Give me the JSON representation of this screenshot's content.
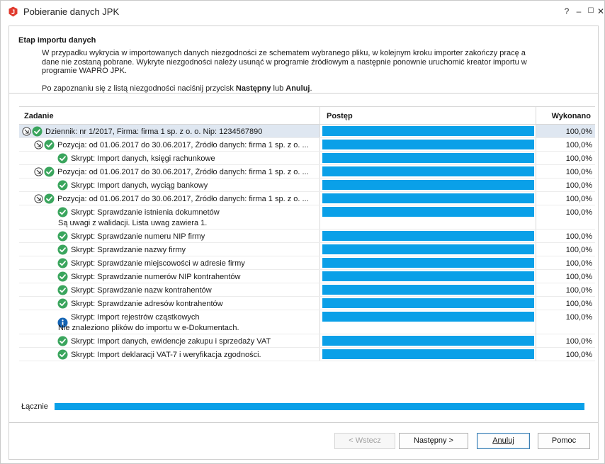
{
  "window": {
    "title": "Pobieranie danych JPK",
    "controls": {
      "help": "?",
      "minimize": "–",
      "maximize": "☐",
      "close": "✕"
    }
  },
  "header": {
    "title": "Etap importu danych",
    "description": "W przypadku wykrycia w importowanych danych niezgodności ze schematem wybranego pliku, w kolejnym kroku importer zakończy pracę a dane nie zostaną pobrane. Wykryte niezgodności należy usunąć w programie źródłowym a następnie ponownie uruchomić kreator importu w programie WAPRO JPK.",
    "hint_prefix": "Po zapoznaniu się z listą niezgodności naciśnij przycisk ",
    "hint_next": "Następny",
    "hint_mid": " lub ",
    "hint_cancel": "Anuluj",
    "hint_suffix": "."
  },
  "grid": {
    "columns": {
      "task": "Zadanie",
      "progress": "Postęp",
      "done": "Wykonano"
    },
    "rows": [
      {
        "level": 0,
        "expander": true,
        "status": "ok",
        "label": "Dziennik: nr 1/2017, Firma: firma 1 sp. z o. o. Nip: 1234567890",
        "sub": "",
        "progress": 1.0,
        "done": "100,0%",
        "selected": true
      },
      {
        "level": 1,
        "expander": true,
        "status": "ok",
        "label": "Pozycja: od 01.06.2017 do 30.06.2017, Źródło danych: firma 1 sp. z o. ...",
        "sub": "",
        "progress": 1.0,
        "done": "100,0%"
      },
      {
        "level": 2,
        "expander": false,
        "status": "ok",
        "label": "Skrypt: Import danych, księgi rachunkowe",
        "sub": "",
        "progress": 1.0,
        "done": "100,0%"
      },
      {
        "level": 1,
        "expander": true,
        "status": "ok",
        "label": "Pozycja: od 01.06.2017 do 30.06.2017, Źródło danych: firma 1 sp. z o. ...",
        "sub": "",
        "progress": 1.0,
        "done": "100,0%"
      },
      {
        "level": 2,
        "expander": false,
        "status": "ok",
        "label": "Skrypt: Import danych, wyciąg bankowy",
        "sub": "",
        "progress": 1.0,
        "done": "100,0%"
      },
      {
        "level": 1,
        "expander": true,
        "status": "ok",
        "label": "Pozycja: od 01.06.2017 do 30.06.2017, Źródło danych: firma 1 sp. z o. ...",
        "sub": "",
        "progress": 1.0,
        "done": "100,0%"
      },
      {
        "level": 2,
        "expander": false,
        "status": "ok",
        "label": "Skrypt: Sprawdzanie istnienia dokumnetów",
        "sub": "Są uwagi z walidacji. Lista uwag zawiera 1.",
        "progress": 1.0,
        "done": "100,0%"
      },
      {
        "level": 2,
        "expander": false,
        "status": "ok",
        "label": "Skrypt: Sprawdzanie numeru NIP firmy",
        "sub": "",
        "progress": 1.0,
        "done": "100,0%"
      },
      {
        "level": 2,
        "expander": false,
        "status": "ok",
        "label": "Skrypt: Sprawdzanie nazwy firmy",
        "sub": "",
        "progress": 1.0,
        "done": "100,0%"
      },
      {
        "level": 2,
        "expander": false,
        "status": "ok",
        "label": "Skrypt: Sprawdzanie miejscowości w adresie firmy",
        "sub": "",
        "progress": 1.0,
        "done": "100,0%"
      },
      {
        "level": 2,
        "expander": false,
        "status": "ok",
        "label": "Skrypt: Sprawdzanie numerów NIP kontrahentów",
        "sub": "",
        "progress": 1.0,
        "done": "100,0%"
      },
      {
        "level": 2,
        "expander": false,
        "status": "ok",
        "label": "Skrypt: Sprawdzanie nazw kontrahentów",
        "sub": "",
        "progress": 1.0,
        "done": "100,0%"
      },
      {
        "level": 2,
        "expander": false,
        "status": "ok",
        "label": "Skrypt: Sprawdzanie adresów kontrahentów",
        "sub": "",
        "progress": 1.0,
        "done": "100,0%"
      },
      {
        "level": 2,
        "expander": false,
        "status": "info",
        "label": "Skrypt: Import rejestrów cząstkowych",
        "sub": "Nie znaleziono plików do importu w e-Dokumentach.",
        "progress": 1.0,
        "done": "100,0%"
      },
      {
        "level": 2,
        "expander": false,
        "status": "ok",
        "label": "Skrypt: Import danych, ewidencje zakupu i sprzedaży VAT",
        "sub": "",
        "progress": 1.0,
        "done": "100,0%"
      },
      {
        "level": 2,
        "expander": false,
        "status": "ok",
        "label": "Skrypt: Import deklaracji VAT-7 i weryfikacja zgodności.",
        "sub": "",
        "progress": 1.0,
        "done": "100,0%"
      }
    ]
  },
  "total": {
    "label": "Łącznie",
    "progress": 1.0
  },
  "buttons": {
    "back": "< Wstecz",
    "next": "Następny >",
    "cancel": "Anuluj",
    "help": "Pomoc"
  },
  "colors": {
    "progress": "#0aa0e8",
    "ok": "#3aa55d",
    "info": "#1464b4",
    "app_icon": "#e03a2e",
    "selected_row": "#dfe7f1"
  }
}
